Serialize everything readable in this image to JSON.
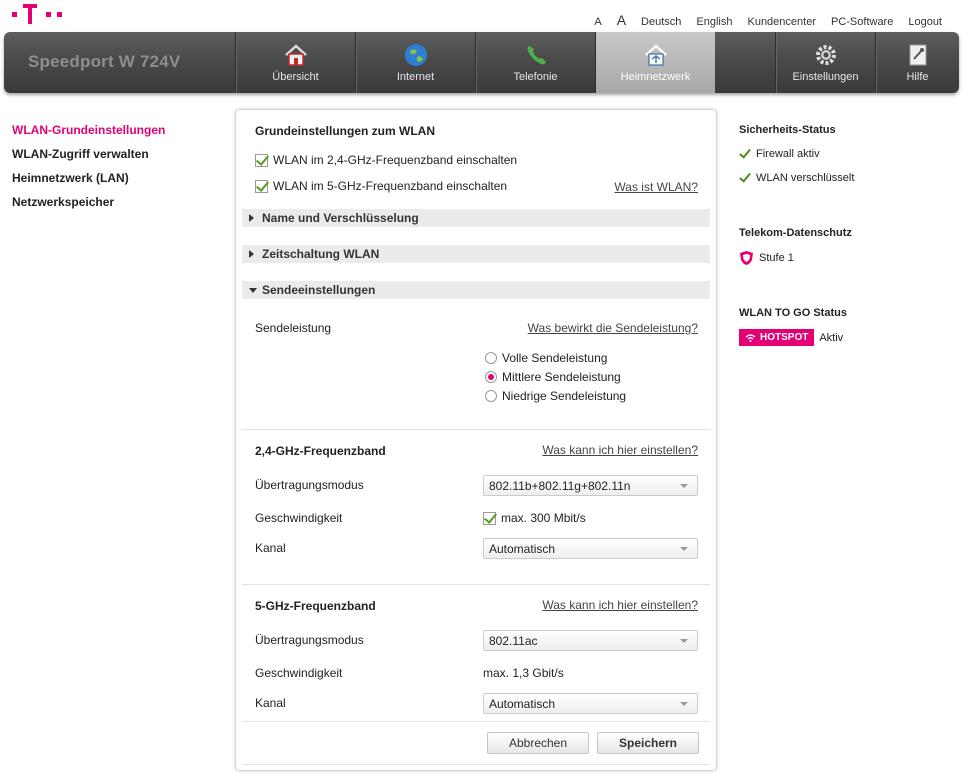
{
  "brand": "Speedport W 724V",
  "toplinks": {
    "a_small": "A",
    "a_large": "A",
    "deutsch": "Deutsch",
    "english": "English",
    "kundencenter": "Kundencenter",
    "pc_software": "PC-Software",
    "logout": "Logout"
  },
  "nav": [
    {
      "label": "Übersicht",
      "icon": "home-icon"
    },
    {
      "label": "Internet",
      "icon": "globe-icon"
    },
    {
      "label": "Telefonie",
      "icon": "phone-icon"
    },
    {
      "label": "Heimnetzwerk",
      "icon": "network-house-icon",
      "active": true
    },
    {
      "label": "Einstellungen",
      "icon": "gear-icon"
    },
    {
      "label": "Hilfe",
      "icon": "help-book-icon"
    }
  ],
  "leftnav": [
    "WLAN-Grundeinstellungen",
    "WLAN-Zugriff verwalten",
    "Heimnetzwerk (LAN)",
    "Netzwerkspeicher"
  ],
  "main": {
    "title": "Grundeinstellungen zum WLAN",
    "cb24": "WLAN im 2,4-GHz-Frequenzband einschalten",
    "cb5": "WLAN im 5-GHz-Frequenzband einschalten",
    "was_ist_wlan": "Was ist WLAN?",
    "sections": [
      "Name und Verschlüsselung",
      "Zeitschaltung WLAN",
      "Sendeeinstellungen"
    ],
    "sendeleistung": {
      "label": "Sendeleistung",
      "help": "Was bewirkt die Sendeleistung?",
      "options": [
        "Volle Sendeleistung",
        "Mittlere Sendeleistung",
        "Niedrige Sendeleistung"
      ],
      "selected": "Mittlere Sendeleistung"
    },
    "band24": {
      "title": "2,4-GHz-Frequenzband",
      "help": "Was kann ich hier einstellen?",
      "mode_label": "Übertragungsmodus",
      "mode_value": "802.11b+802.11g+802.11n",
      "speed_label": "Geschwindigkeit",
      "speed_value": "max. 300 Mbit/s",
      "channel_label": "Kanal",
      "channel_value": "Automatisch"
    },
    "band5": {
      "title": "5-GHz-Frequenzband",
      "help": "Was kann ich hier einstellen?",
      "mode_label": "Übertragungsmodus",
      "mode_value": "802.11ac",
      "speed_label": "Geschwindigkeit",
      "speed_value": "max. 1,3 Gbit/s",
      "channel_label": "Kanal",
      "channel_value": "Automatisch"
    },
    "cancel": "Abbrechen",
    "save": "Speichern"
  },
  "right": {
    "sec_title": "Sicherheits-Status",
    "firewall": "Firewall aktiv",
    "wlan_enc": "WLAN verschlüsselt",
    "privacy_title": "Telekom-Datenschutz",
    "privacy_level": "Stufe 1",
    "togo_title": "WLAN TO GO Status",
    "hotspot": "HOTSPOT",
    "togo_status": "Aktiv"
  },
  "colors": {
    "accent": "#e20074"
  }
}
